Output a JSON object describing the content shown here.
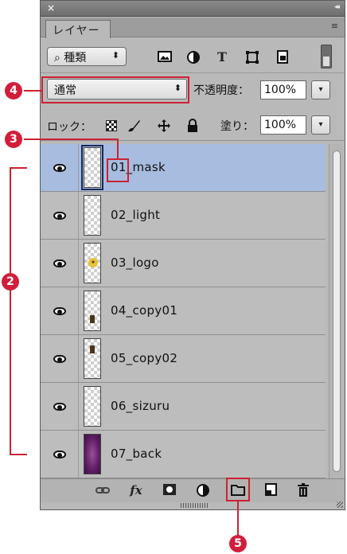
{
  "panel": {
    "title_bar": {
      "close": "×",
      "collapse": "◂◂"
    },
    "tab": {
      "label": "レイヤー",
      "menu_icon": "≡"
    },
    "filter": {
      "kind_label": "種類",
      "kind_prefix": "⌕",
      "arrows": "⬍",
      "icons": [
        "image-filter-icon",
        "adjustment-filter-icon",
        "type-filter-icon",
        "shape-filter-icon",
        "smart-object-filter-icon",
        "filter-toggle"
      ]
    },
    "blend": {
      "mode": "通常",
      "arrows": "⬍",
      "opacity_label": "不透明度：",
      "opacity_value": "100%"
    },
    "lock": {
      "label": "ロック：",
      "fill_label": "塗り：",
      "fill_value": "100%"
    },
    "layers": [
      {
        "name": "01_mask",
        "thumb": "empty",
        "selected": true
      },
      {
        "name": "02_light",
        "thumb": "empty",
        "selected": false
      },
      {
        "name": "03_logo",
        "thumb": "logo",
        "selected": false
      },
      {
        "name": "04_copy01",
        "thumb": "mark-low",
        "selected": false
      },
      {
        "name": "05_copy02",
        "thumb": "mark-high",
        "selected": false
      },
      {
        "name": "06_sizuru",
        "thumb": "empty",
        "selected": false
      },
      {
        "name": "07_back",
        "thumb": "purple",
        "selected": false
      }
    ],
    "bottom_icons": [
      "link-icon",
      "fx-icon",
      "mask-icon",
      "adjustment-icon",
      "folder-icon",
      "new-layer-icon",
      "trash-icon"
    ],
    "fx_label": "fx"
  },
  "annotations": {
    "callout_2": "2",
    "callout_3": "3",
    "callout_4": "4",
    "callout_5": "5",
    "accent_color": "#d11e3a"
  }
}
